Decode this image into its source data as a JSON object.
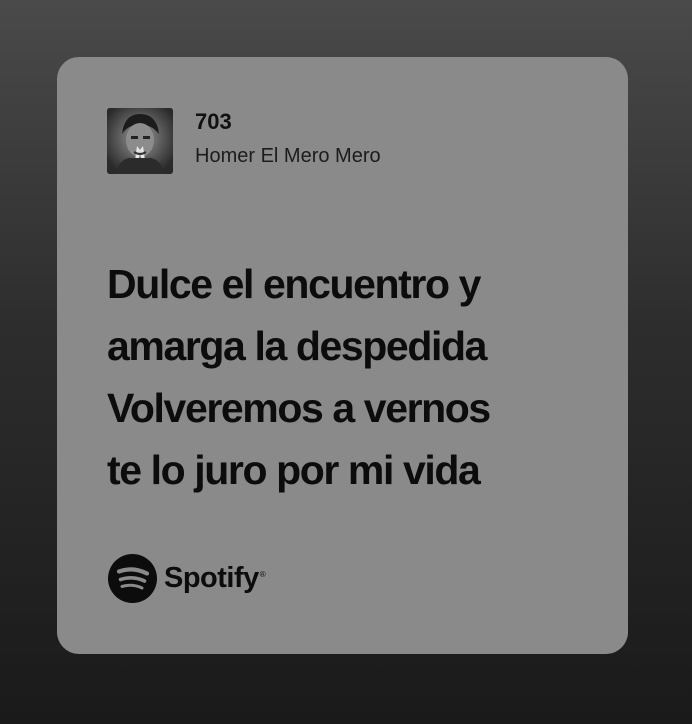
{
  "track": {
    "title": "703",
    "artist": "Homer El Mero Mero",
    "cover_icon": "album-cover-image"
  },
  "lyrics": {
    "lines": [
      "Dulce el encuentro y",
      "amarga la despedida",
      "Volveremos a vernos",
      "te lo juro por mi vida"
    ]
  },
  "brand": {
    "name": "Spotify",
    "registered": "®",
    "logo_icon": "spotify-logo-icon"
  },
  "colors": {
    "card_background": "#8a8a8a",
    "text": "#0c0c0c",
    "page_gradient_top": "#4a4a4a",
    "page_gradient_bottom": "#1a1a1a"
  }
}
